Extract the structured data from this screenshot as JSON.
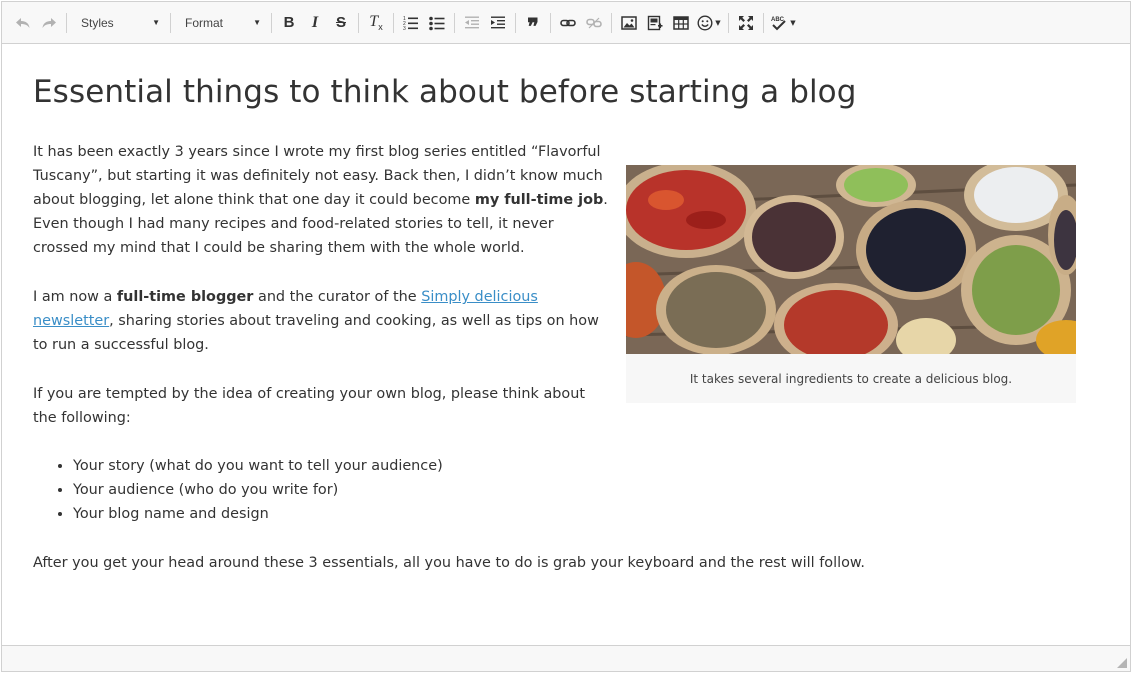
{
  "toolbar": {
    "styles_label": "Styles",
    "format_label": "Format",
    "bold": "B",
    "italic": "I",
    "strike": "S",
    "clear_format": "T",
    "clear_format_sub": "x",
    "blockquote": "❞"
  },
  "document": {
    "heading": "Essential things to think about before starting a blog",
    "p1": {
      "t1": "It has been exactly 3 years since I wrote my first blog series entitled “Flavorful Tuscany”, but starting it was definitely not easy. Back then, I didn’t know much about blogging, let alone think that one day it could become ",
      "bold": "my full-time job",
      "t2": ". Even though I had many recipes and food-related stories to tell, it never crossed my mind that I could be sharing them with the whole world."
    },
    "p2": {
      "t1": "I am now a ",
      "bold": "full-time blogger",
      "t2": " and the curator of the ",
      "link": "Simply delicious newsletter",
      "t3": ", sharing stories about traveling and cooking, as well as tips on how to run a successful blog."
    },
    "p3": "If you are tempted by the idea of creating your own blog, please think about the following:",
    "list": [
      "Your story (what do you want to tell your audience)",
      "Your audience (who do you write for)",
      "Your blog name and design"
    ],
    "p4": "After you get your head around these 3 essentials, all you have to do is grab your keyboard and the rest will follow.",
    "figure_caption": "It takes several ingredients to create a delicious blog."
  },
  "colors": {
    "link": "#3a8ec7",
    "toolbar_bg": "#f8f8f8",
    "border": "#d1d1d1",
    "text": "#333333"
  }
}
